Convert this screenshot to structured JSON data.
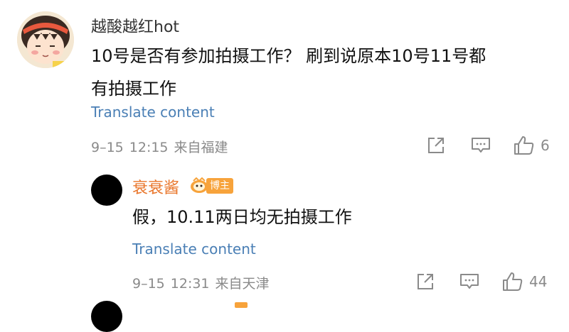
{
  "comment": {
    "username": "越酸越红hot",
    "body_lines": [
      "10号是否有参加拍摄工作？ 刷到说原本10号11号都",
      "有拍摄工作"
    ],
    "translate": "Translate content",
    "date": "9–15",
    "time": "12:15",
    "location": "来自福建",
    "like_count": "6"
  },
  "reply": {
    "username": "衰衰酱",
    "badge": "博主",
    "body": "假，10.11两日均无拍摄工作",
    "translate": "Translate content",
    "date": "9–15",
    "time": "12:31",
    "location": "来自天津",
    "like_count": "44"
  },
  "colors": {
    "link": "#4a7fb5",
    "author_name": "#e9762b",
    "meta": "#8a8a8a",
    "badge": "#f7a33b"
  }
}
